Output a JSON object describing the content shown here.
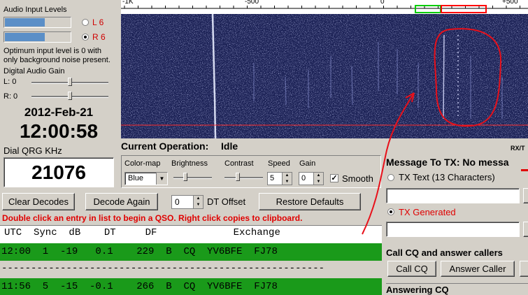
{
  "audio": {
    "title": "Audio Input Levels",
    "left_label": "L 6",
    "right_label": "R 6",
    "left_level": 0.6,
    "right_level": 0.6,
    "hint": "Optimum input level is 0 with only background noise present.",
    "gain_title": "Digital Audio Gain",
    "gain_l": "L: 0",
    "gain_r": "R: 0"
  },
  "clock": {
    "date": "2012-Feb-21",
    "time": "12:00:58",
    "qrg_label": "Dial QRG KHz",
    "qrg_value": "21076"
  },
  "waterfall": {
    "scale_labels": [
      "-1K",
      "-500",
      "0",
      "+500"
    ],
    "status_label": "Current Operation:",
    "status_value": "Idle",
    "rxtx_label": "RX/T"
  },
  "controls": {
    "colormap_label": "Color-map",
    "colormap_value": "Blue",
    "brightness_label": "Brightness",
    "contrast_label": "Contrast",
    "speed_label": "Speed",
    "speed_value": "5",
    "gain_label": "Gain",
    "gain_value": "0",
    "smooth_label": "Smooth"
  },
  "buttons": {
    "clear_decodes": "Clear Decodes",
    "decode_again": "Decode Again",
    "dt_value": "0",
    "dt_label": "DT Offset",
    "restore_defaults": "Restore Defaults"
  },
  "instruction": "Double click an entry in list to begin a QSO.  Right click copies to clipboard.",
  "decodes": {
    "header": "UTC  Sync  dB    DT     DF             Exchange",
    "rows": [
      "12:00  1  -19   0.1    229  B  CQ  YV6BFE  FJ78",
      "-------------------------------------------------------",
      "11:56  5  -15  -0.1    266  B  CQ  YV6BFE  FJ78"
    ]
  },
  "tx": {
    "title": "Message To TX:  No messa",
    "tx_text_label": "TX Text (13 Characters)",
    "tx_generated_label": "TX Generated",
    "cq_section": "Call CQ and answer callers",
    "call_cq": "Call CQ",
    "answer_caller": "Answer Caller",
    "answering": "Answering CQ"
  },
  "colors": {
    "decode_row": "#1a9a1a",
    "instruction_red": "#e00000",
    "annotation_red": "#e8101a",
    "waterfall_bg": "#1a1f52"
  }
}
